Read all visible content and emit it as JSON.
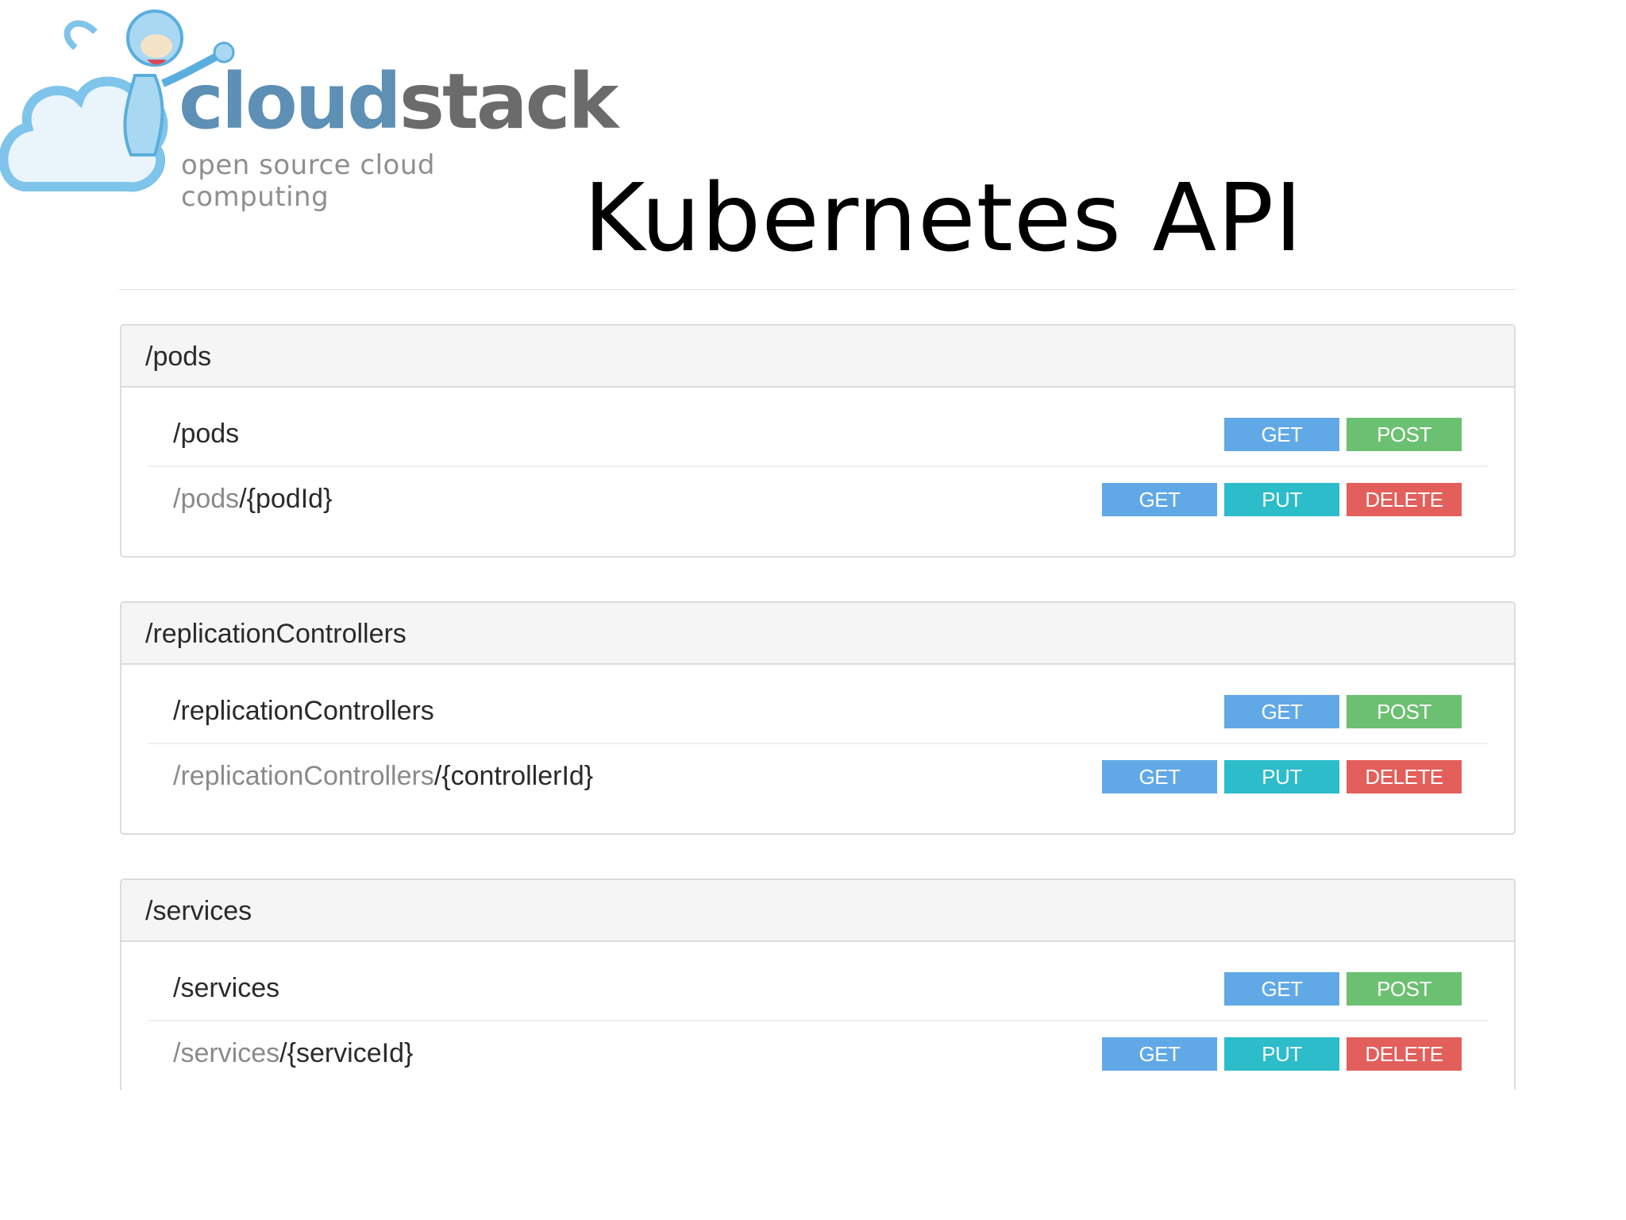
{
  "logo": {
    "word_part1": "cloud",
    "word_part2": "stack",
    "tagline": "open source cloud computing",
    "icon": "cloud-monkey-icon",
    "colors": {
      "blue": "#5e8fb5",
      "grey": "#6b6b6b",
      "cloud": "#7fc4ea"
    }
  },
  "title": "Kubernetes API",
  "sections": [
    {
      "header": "/pods",
      "rows": [
        {
          "dim": "",
          "path": "/pods",
          "methods": [
            "GET",
            "POST"
          ]
        },
        {
          "dim": "/pods",
          "path": "/{podId}",
          "methods": [
            "GET",
            "PUT",
            "DELETE"
          ]
        }
      ]
    },
    {
      "header": "/replicationControllers",
      "rows": [
        {
          "dim": "",
          "path": "/replicationControllers",
          "methods": [
            "GET",
            "POST"
          ]
        },
        {
          "dim": "/replicationControllers",
          "path": "/{controllerId}",
          "methods": [
            "GET",
            "PUT",
            "DELETE"
          ]
        }
      ]
    },
    {
      "header": "/services",
      "rows": [
        {
          "dim": "",
          "path": "/services",
          "methods": [
            "GET",
            "POST"
          ]
        },
        {
          "dim": "/services",
          "path": "/{serviceId}",
          "methods": [
            "GET",
            "PUT",
            "DELETE"
          ]
        }
      ]
    }
  ],
  "method_colors": {
    "GET": "#61a9e6",
    "POST": "#6cc072",
    "PUT": "#2cbcca",
    "DELETE": "#e35f5b"
  }
}
